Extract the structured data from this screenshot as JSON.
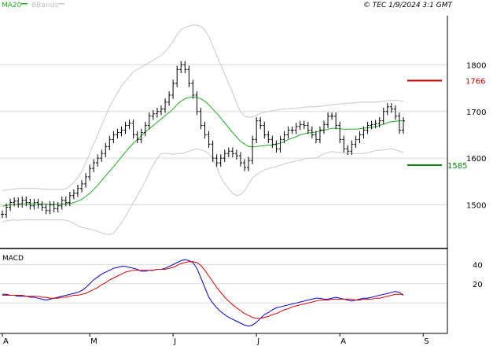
{
  "header": {
    "legend_ma": "MA20",
    "legend_bb": "BBands",
    "copyright": "© TEC 1/9/2024 3:1 GMT"
  },
  "colors": {
    "price": "#000000",
    "ma": "#22aa22",
    "bands": "#c8c8c8",
    "resistance": "#cc0000",
    "support": "#008800",
    "macd": "#0000cc",
    "signal": "#dd0000",
    "grid": "#dcdcdc"
  },
  "chart_data": [
    {
      "type": "line",
      "panel": "price",
      "y_ticks": [
        1500,
        1600,
        1700,
        1800
      ],
      "y_tick_labels": [
        "1500",
        "1600",
        "1700",
        "1800"
      ],
      "ylim": [
        1410,
        1905
      ],
      "x_labels": [
        "A",
        "M",
        "J",
        "J",
        "A",
        "S"
      ],
      "x_label_index": [
        0,
        22,
        43,
        64,
        85,
        106
      ],
      "resistance": {
        "value": 1766,
        "label": "1766"
      },
      "support": {
        "value": 1585,
        "label": "1585"
      },
      "close": [
        1480,
        1495,
        1505,
        1508,
        1502,
        1510,
        1505,
        1498,
        1505,
        1500,
        1495,
        1488,
        1500,
        1492,
        1498,
        1510,
        1505,
        1520,
        1525,
        1535,
        1545,
        1560,
        1578,
        1590,
        1600,
        1610,
        1625,
        1640,
        1650,
        1655,
        1660,
        1670,
        1675,
        1650,
        1640,
        1655,
        1670,
        1690,
        1695,
        1700,
        1705,
        1720,
        1735,
        1760,
        1790,
        1800,
        1790,
        1760,
        1735,
        1700,
        1670,
        1650,
        1630,
        1600,
        1590,
        1600,
        1610,
        1615,
        1610,
        1605,
        1590,
        1580,
        1595,
        1640,
        1680,
        1670,
        1650,
        1640,
        1630,
        1620,
        1640,
        1650,
        1660,
        1660,
        1668,
        1672,
        1670,
        1660,
        1650,
        1640,
        1660,
        1672,
        1690,
        1690,
        1670,
        1640,
        1620,
        1615,
        1630,
        1640,
        1650,
        1660,
        1670,
        1672,
        1674,
        1680,
        1700,
        1710,
        1705,
        1690,
        1660,
        1680
      ],
      "ma20": [
        1497,
        1499,
        1500,
        1501,
        1501,
        1502,
        1502,
        1502,
        1502,
        1502,
        1502,
        1501,
        1501,
        1501,
        1501,
        1502,
        1502,
        1503,
        1505,
        1508,
        1512,
        1518,
        1525,
        1533,
        1542,
        1552,
        1562,
        1572,
        1582,
        1592,
        1603,
        1613,
        1623,
        1632,
        1640,
        1648,
        1656,
        1663,
        1670,
        1677,
        1684,
        1691,
        1698,
        1705,
        1715,
        1722,
        1727,
        1730,
        1731,
        1730,
        1727,
        1722,
        1714,
        1705,
        1696,
        1686,
        1676,
        1665,
        1655,
        1645,
        1636,
        1630,
        1625,
        1624,
        1625,
        1626,
        1627,
        1628,
        1628,
        1630,
        1632,
        1636,
        1640,
        1643,
        1646,
        1650,
        1652,
        1654,
        1655,
        1656,
        1658,
        1660,
        1662,
        1664,
        1664,
        1663,
        1662,
        1662,
        1662,
        1662,
        1663,
        1664,
        1665,
        1666,
        1668,
        1670,
        1673,
        1676,
        1678,
        1679,
        1680,
        1680
      ],
      "upper_band": [
        1530,
        1532,
        1533,
        1534,
        1535,
        1535,
        1535,
        1535,
        1535,
        1535,
        1534,
        1534,
        1533,
        1533,
        1533,
        1533,
        1535,
        1540,
        1548,
        1558,
        1572,
        1590,
        1610,
        1630,
        1650,
        1670,
        1690,
        1710,
        1725,
        1740,
        1755,
        1765,
        1775,
        1785,
        1790,
        1795,
        1800,
        1805,
        1810,
        1815,
        1820,
        1828,
        1838,
        1850,
        1865,
        1875,
        1880,
        1883,
        1885,
        1885,
        1882,
        1875,
        1860,
        1840,
        1820,
        1800,
        1780,
        1760,
        1740,
        1718,
        1700,
        1690,
        1688,
        1688,
        1692,
        1696,
        1698,
        1700,
        1702,
        1703,
        1704,
        1705,
        1706,
        1706,
        1707,
        1708,
        1709,
        1710,
        1710,
        1710,
        1711,
        1712,
        1713,
        1714,
        1715,
        1716,
        1717,
        1718,
        1718,
        1719,
        1720,
        1720,
        1720,
        1720,
        1720,
        1721,
        1722,
        1723,
        1724,
        1724,
        1723,
        1722
      ],
      "lower_band": [
        1463,
        1466,
        1467,
        1468,
        1467,
        1468,
        1468,
        1468,
        1468,
        1468,
        1468,
        1468,
        1468,
        1468,
        1468,
        1468,
        1467,
        1465,
        1460,
        1455,
        1452,
        1450,
        1448,
        1446,
        1443,
        1440,
        1438,
        1436,
        1440,
        1450,
        1462,
        1475,
        1490,
        1505,
        1520,
        1535,
        1550,
        1570,
        1585,
        1600,
        1610,
        1610,
        1610,
        1608,
        1610,
        1610,
        1612,
        1615,
        1618,
        1620,
        1618,
        1615,
        1610,
        1600,
        1580,
        1560,
        1545,
        1535,
        1525,
        1520,
        1522,
        1530,
        1545,
        1558,
        1565,
        1570,
        1575,
        1578,
        1580,
        1582,
        1585,
        1588,
        1590,
        1592,
        1594,
        1596,
        1598,
        1600,
        1600,
        1600,
        1605,
        1610,
        1612,
        1614,
        1613,
        1612,
        1611,
        1610,
        1610,
        1610,
        1610,
        1610,
        1612,
        1614,
        1616,
        1617,
        1618,
        1619,
        1620,
        1618,
        1615,
        1612
      ]
    },
    {
      "type": "line",
      "panel": "macd",
      "title": "MACD",
      "y_ticks": [
        20,
        40
      ],
      "y_tick_labels": [
        "20",
        "40"
      ],
      "ylim": [
        -30,
        55
      ],
      "macd": [
        9,
        9,
        8,
        8,
        7,
        7,
        7,
        6,
        6,
        5,
        4,
        3,
        4,
        5,
        6,
        7,
        8,
        9,
        10,
        11,
        13,
        16,
        20,
        24,
        27,
        30,
        32,
        34,
        36,
        37,
        38,
        38,
        37,
        36,
        35,
        33,
        33,
        34,
        34,
        35,
        35,
        36,
        38,
        40,
        42,
        44,
        45,
        44,
        42,
        36,
        26,
        16,
        6,
        0,
        -5,
        -9,
        -12,
        -15,
        -17,
        -19,
        -21,
        -23,
        -24,
        -23,
        -20,
        -16,
        -12,
        -10,
        -7,
        -5,
        -4,
        -3,
        -2,
        -1,
        0,
        1,
        2,
        3,
        4,
        5,
        5,
        4,
        4,
        5,
        6,
        5,
        4,
        3,
        2,
        3,
        4,
        5,
        5,
        6,
        7,
        8,
        9,
        10,
        11,
        12,
        11,
        8
      ],
      "signal": [
        8,
        8,
        8,
        8,
        8,
        8,
        7,
        7,
        7,
        7,
        6,
        6,
        5,
        5,
        5,
        6,
        6,
        7,
        8,
        8,
        9,
        10,
        12,
        14,
        16,
        19,
        21,
        24,
        26,
        28,
        30,
        32,
        33,
        34,
        34,
        34,
        34,
        34,
        34,
        35,
        35,
        35,
        36,
        37,
        39,
        41,
        42,
        43,
        43,
        42,
        39,
        34,
        28,
        22,
        16,
        11,
        6,
        2,
        -2,
        -5,
        -8,
        -11,
        -13,
        -15,
        -16,
        -16,
        -15,
        -14,
        -12,
        -11,
        -9,
        -7,
        -6,
        -4,
        -3,
        -2,
        -1,
        0,
        1,
        2,
        3,
        3,
        3,
        4,
        4,
        4,
        4,
        4,
        4,
        3,
        3,
        4,
        4,
        4,
        5,
        5,
        6,
        7,
        8,
        9,
        9,
        9
      ]
    }
  ]
}
